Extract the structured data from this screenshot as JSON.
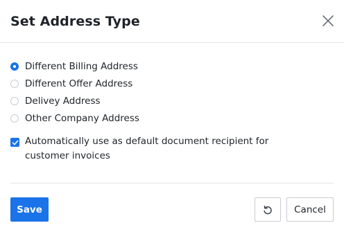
{
  "dialog": {
    "title": "Set Address Type",
    "close_icon": "close-icon"
  },
  "address_types": [
    {
      "label": "Different Billing Address",
      "selected": true
    },
    {
      "label": "Different Offer Address",
      "selected": false
    },
    {
      "label": "Delivey Address",
      "selected": false
    },
    {
      "label": "Other Company Address",
      "selected": false
    }
  ],
  "default_recipient": {
    "label": "Automatically use as default document recipient for customer invoices",
    "checked": true
  },
  "footer": {
    "save_label": "Save",
    "reset_icon": "reset-icon",
    "cancel_label": "Cancel"
  },
  "colors": {
    "accent": "#1a73e8",
    "border": "#c9ccd1",
    "divider": "#e3e5e8",
    "text": "#1f2328"
  }
}
